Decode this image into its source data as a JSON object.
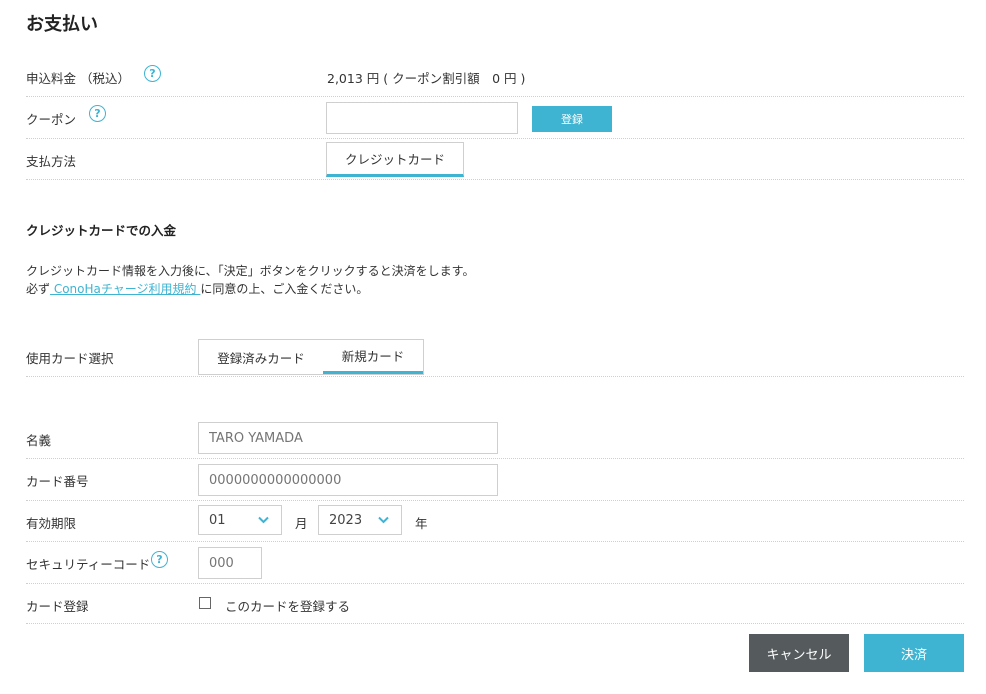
{
  "page": {
    "title": "お支払い"
  },
  "fee": {
    "label": "申込料金 （税込）",
    "help": "?",
    "value": "2,013 円 ( クーポン割引額　0 円 )"
  },
  "coupon": {
    "label": "クーポン",
    "help": "?",
    "value": "",
    "register_label": "登録"
  },
  "payment_method": {
    "label": "支払方法",
    "tab": "クレジットカード"
  },
  "credit_section": {
    "title": "クレジットカードでの入金",
    "desc1": "クレジットカード情報を入力後に、「決定」ボタンをクリックすると決済をします。",
    "desc2_prefix": "必ず",
    "terms_link": " ConoHaチャージ利用規約 ",
    "desc2_suffix": "に同意の上、ご入金ください。"
  },
  "card_select": {
    "label": "使用カード選択",
    "tabs": [
      "登録済みカード",
      "新規カード"
    ],
    "active": "新規カード"
  },
  "name_field": {
    "label": "名義",
    "placeholder": "TARO YAMADA"
  },
  "number_field": {
    "label": "カード番号",
    "placeholder": "0000000000000000"
  },
  "expiry": {
    "label": "有効期限",
    "month": "01",
    "month_unit": "月",
    "year": "2023",
    "year_unit": "年"
  },
  "security": {
    "label": "セキュリティーコード",
    "help": "?",
    "placeholder": "000"
  },
  "register_card": {
    "label": "カード登録",
    "checkbox_label": "このカードを登録する",
    "checked": false
  },
  "actions": {
    "cancel": "キャンセル",
    "submit": "決済"
  },
  "colors": {
    "accent": "#3fb4d2",
    "cancel_bg": "#555a5d",
    "divider": "#cfcfcf"
  }
}
